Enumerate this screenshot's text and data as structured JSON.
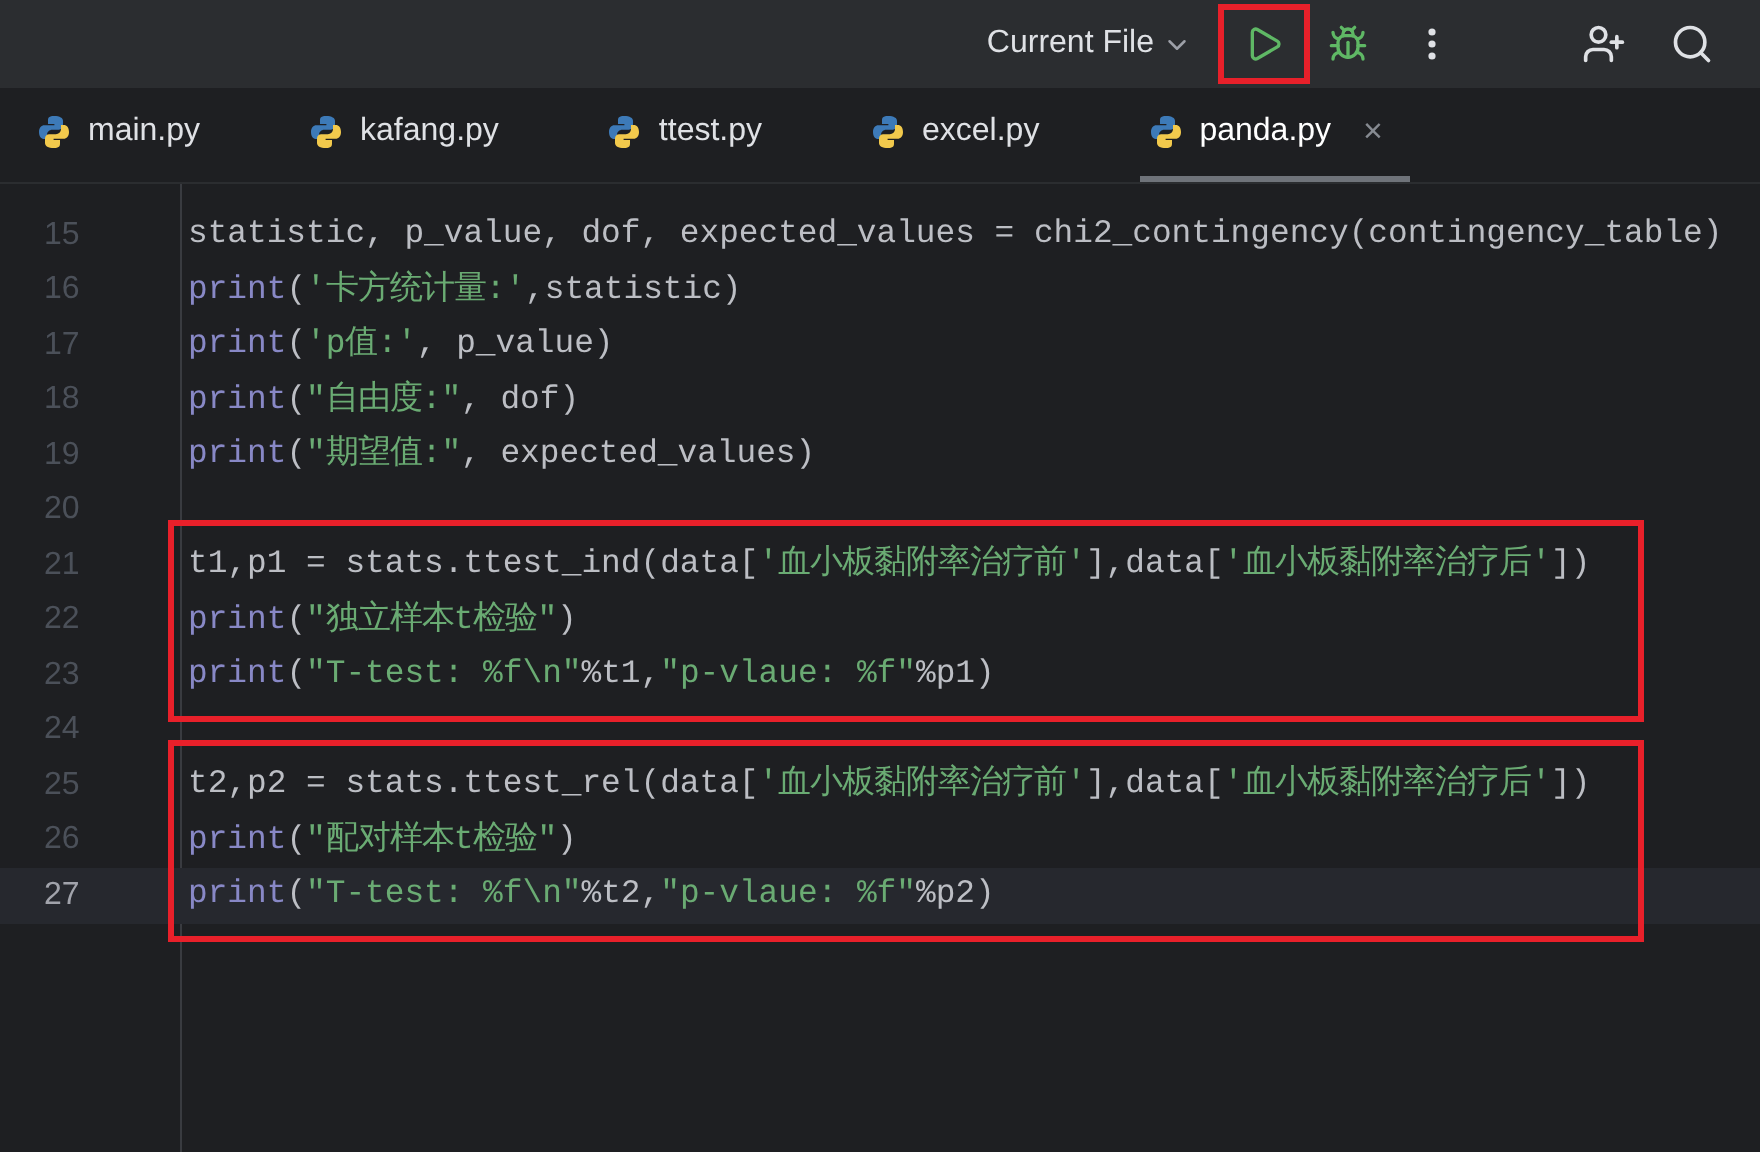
{
  "toolbar": {
    "run_config": "Current File",
    "run_highlighted": true
  },
  "tabs": [
    {
      "label": "main.py",
      "selected": false
    },
    {
      "label": "kafang.py",
      "selected": false
    },
    {
      "label": "ttest.py",
      "selected": false
    },
    {
      "label": "excel.py",
      "selected": false
    },
    {
      "label": "panda.py",
      "selected": true,
      "close": "×"
    }
  ],
  "editor": {
    "blocks": [
      {
        "boxed": false,
        "lines": [
          {
            "number": "15",
            "current": false,
            "tokens": [
              {
                "kind": "plain",
                "text": "statistic, p_value, dof, expected_values = chi2_contingency(contingency_table)"
              }
            ]
          },
          {
            "number": "16",
            "current": false,
            "tokens": [
              {
                "kind": "builtin",
                "text": "print"
              },
              {
                "kind": "plain",
                "text": "("
              },
              {
                "kind": "string",
                "text": "'卡方统计量:'"
              },
              {
                "kind": "plain",
                "text": ",statistic)"
              }
            ]
          },
          {
            "number": "17",
            "current": false,
            "tokens": [
              {
                "kind": "builtin",
                "text": "print"
              },
              {
                "kind": "plain",
                "text": "("
              },
              {
                "kind": "string",
                "text": "'p值:'"
              },
              {
                "kind": "plain",
                "text": ", p_value)"
              }
            ]
          },
          {
            "number": "18",
            "current": false,
            "tokens": [
              {
                "kind": "builtin",
                "text": "print"
              },
              {
                "kind": "plain",
                "text": "("
              },
              {
                "kind": "string",
                "text": "\"自由度:\""
              },
              {
                "kind": "plain",
                "text": ", dof)"
              }
            ]
          },
          {
            "number": "19",
            "current": false,
            "tokens": [
              {
                "kind": "builtin",
                "text": "print"
              },
              {
                "kind": "plain",
                "text": "("
              },
              {
                "kind": "string",
                "text": "\"期望值:\""
              },
              {
                "kind": "plain",
                "text": ", expected_values)"
              }
            ]
          },
          {
            "number": "20",
            "current": false
          }
        ]
      },
      {
        "boxed": true,
        "lines": [
          {
            "number": "21",
            "current": false,
            "tokens": [
              {
                "kind": "plain",
                "text": "t1,p1 = stats.ttest_ind(data["
              },
              {
                "kind": "string",
                "text": "'血小板黏附率治疗前'"
              },
              {
                "kind": "plain",
                "text": "],data["
              },
              {
                "kind": "string",
                "text": "'血小板黏附率治疗后'"
              },
              {
                "kind": "plain",
                "text": "])"
              }
            ]
          },
          {
            "number": "22",
            "current": false,
            "tokens": [
              {
                "kind": "builtin",
                "text": "print"
              },
              {
                "kind": "plain",
                "text": "("
              },
              {
                "kind": "string",
                "text": "\"独立样本t检验\""
              },
              {
                "kind": "plain",
                "text": ")"
              }
            ]
          },
          {
            "number": "23",
            "current": false,
            "tokens": [
              {
                "kind": "builtin",
                "text": "print"
              },
              {
                "kind": "plain",
                "text": "("
              },
              {
                "kind": "string",
                "text": "\"T-test: %f\\n\""
              },
              {
                "kind": "plain",
                "text": "%t1,"
              },
              {
                "kind": "string",
                "text": "\"p-vlaue: %f\""
              },
              {
                "kind": "plain",
                "text": "%p1)"
              }
            ]
          }
        ]
      },
      {
        "boxed": false,
        "lines": [
          {
            "number": "24",
            "current": false
          }
        ]
      },
      {
        "boxed": true,
        "lines": [
          {
            "number": "25",
            "current": false,
            "tokens": [
              {
                "kind": "plain",
                "text": "t2,p2 = stats.ttest_rel(data["
              },
              {
                "kind": "string",
                "text": "'血小板黏附率治疗前'"
              },
              {
                "kind": "plain",
                "text": "],data["
              },
              {
                "kind": "string",
                "text": "'血小板黏附率治疗后'"
              },
              {
                "kind": "plain",
                "text": "])"
              }
            ]
          },
          {
            "number": "26",
            "current": false,
            "tokens": [
              {
                "kind": "builtin",
                "text": "print"
              },
              {
                "kind": "plain",
                "text": "("
              },
              {
                "kind": "string",
                "text": "\"配对样本t检验\""
              },
              {
                "kind": "plain",
                "text": ")"
              }
            ]
          },
          {
            "number": "27",
            "current": true,
            "tokens": [
              {
                "kind": "builtin",
                "text": "print"
              },
              {
                "kind": "plain",
                "text": "("
              },
              {
                "kind": "string",
                "text": "\"T-test: %f\\n\""
              },
              {
                "kind": "plain",
                "text": "%t2,"
              },
              {
                "kind": "string",
                "text": "\"p-vlaue: %f\""
              },
              {
                "kind": "plain",
                "text": "%p2)"
              }
            ]
          }
        ]
      }
    ]
  }
}
